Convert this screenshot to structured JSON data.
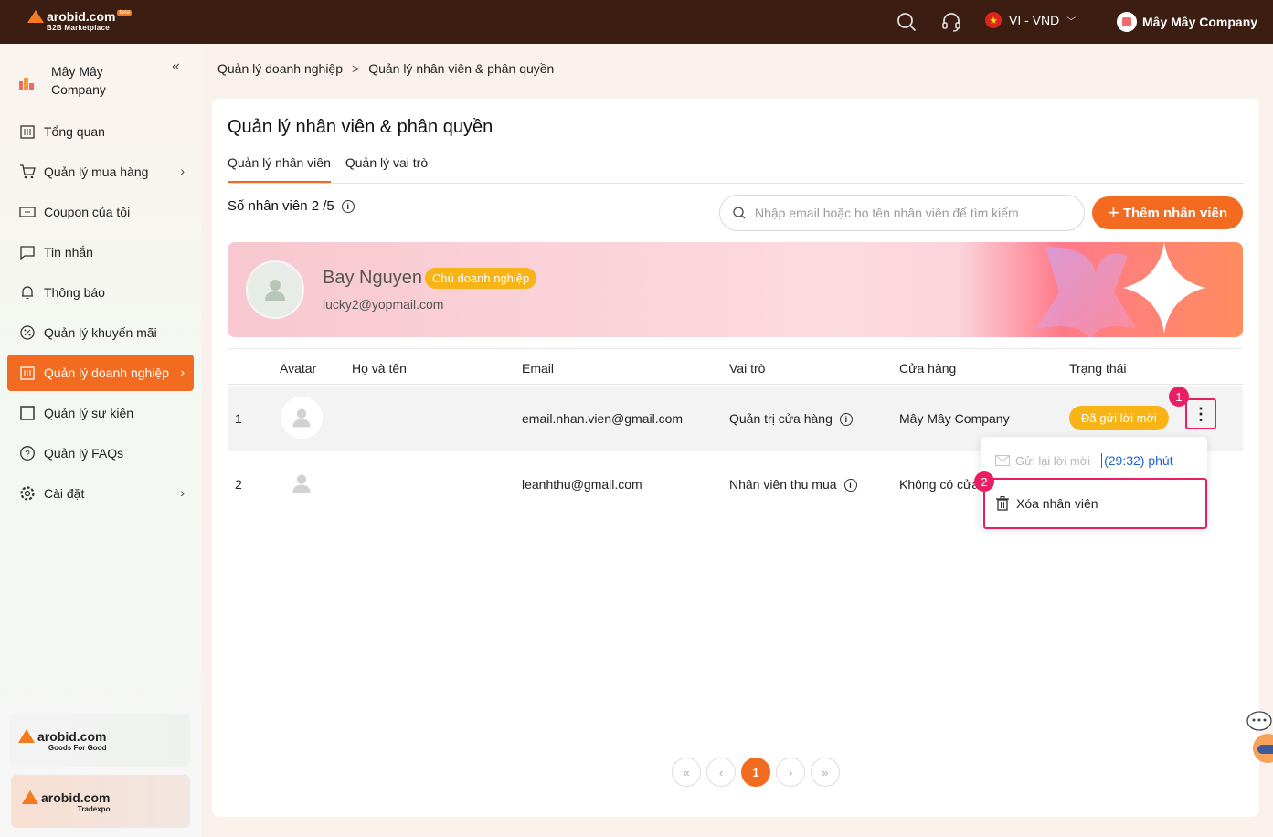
{
  "header": {
    "logo_text": "arobid.com",
    "logo_sub": "B2B Marketplace",
    "logo_badge": "beta",
    "language": "VI - VND",
    "flag_glyph": "★",
    "company_name": "Mây Mây Company"
  },
  "sidebar": {
    "company_name": "Mây Mây Company",
    "items": [
      {
        "label": "Tổng quan",
        "icon": "building-icon",
        "has_arrow": false
      },
      {
        "label": "Quản lý mua hàng",
        "icon": "cart-icon",
        "has_arrow": true
      },
      {
        "label": "Coupon của tôi",
        "icon": "coupon-icon",
        "has_arrow": false
      },
      {
        "label": "Tin nhắn",
        "icon": "message-icon",
        "has_arrow": false
      },
      {
        "label": "Thông báo",
        "icon": "bell-icon",
        "has_arrow": false
      },
      {
        "label": "Quản lý khuyến mãi",
        "icon": "discount-icon",
        "has_arrow": false
      },
      {
        "label": "Quản lý doanh nghiệp",
        "icon": "enterprise-icon",
        "has_arrow": true,
        "active": true
      },
      {
        "label": "Quản lý sự kiện",
        "icon": "event-icon",
        "has_arrow": false
      },
      {
        "label": "Quản lý FAQs",
        "icon": "faq-icon",
        "has_arrow": false
      },
      {
        "label": "Cài đặt",
        "icon": "settings-icon",
        "has_arrow": true
      }
    ],
    "promo1": {
      "title": "arobid.com",
      "sub": "Goods For Good"
    },
    "promo2": {
      "title": "arobid.com",
      "sub": "Tradexpo"
    }
  },
  "breadcrumb": {
    "item1": "Quản lý doanh nghiệp",
    "separator": ">",
    "item2": "Quản lý nhân viên & phân quyền"
  },
  "page": {
    "title": "Quản lý nhân viên & phân quyền",
    "tabs": [
      "Quản lý nhân viên",
      "Quản lý vai trò"
    ],
    "count_label": "Số nhân viên 2 /5",
    "search_placeholder": "Nhập email hoặc họ tên nhân viên để tìm kiếm",
    "add_button": "Thêm nhân viên"
  },
  "owner": {
    "name": "Bay Nguyen",
    "badge": "Chủ doanh nghiệp",
    "email": "lucky2@yopmail.com"
  },
  "table": {
    "headers": [
      "Avatar",
      "Họ và tên",
      "Email",
      "Vai trò",
      "Cửa hàng",
      "Trạng thái"
    ],
    "rows": [
      {
        "index": "1",
        "name": "",
        "email": "email.nhan.vien@gmail.com",
        "role": "Quản trị cửa hàng",
        "store": "Mây Mây Company",
        "status": "Đã gửi lời mời"
      },
      {
        "index": "2",
        "name": "",
        "email": "leanhthu@gmail.com",
        "role": "Nhân viên thu mua",
        "store": "Không có cửa",
        "status": ""
      }
    ]
  },
  "menu": {
    "resend_label": "Gửi lại lời mời",
    "timer": "(29:32) phút",
    "delete_label": "Xóa nhân viên"
  },
  "markers": {
    "step1": "1",
    "step2": "2"
  },
  "pagination": {
    "first": "«",
    "prev": "‹",
    "current": "1",
    "next": "›",
    "last": "»"
  },
  "colors": {
    "brand": "#f36b21",
    "topbar": "#3b1d12",
    "highlight": "#e91e63",
    "status": "#f8b416"
  }
}
